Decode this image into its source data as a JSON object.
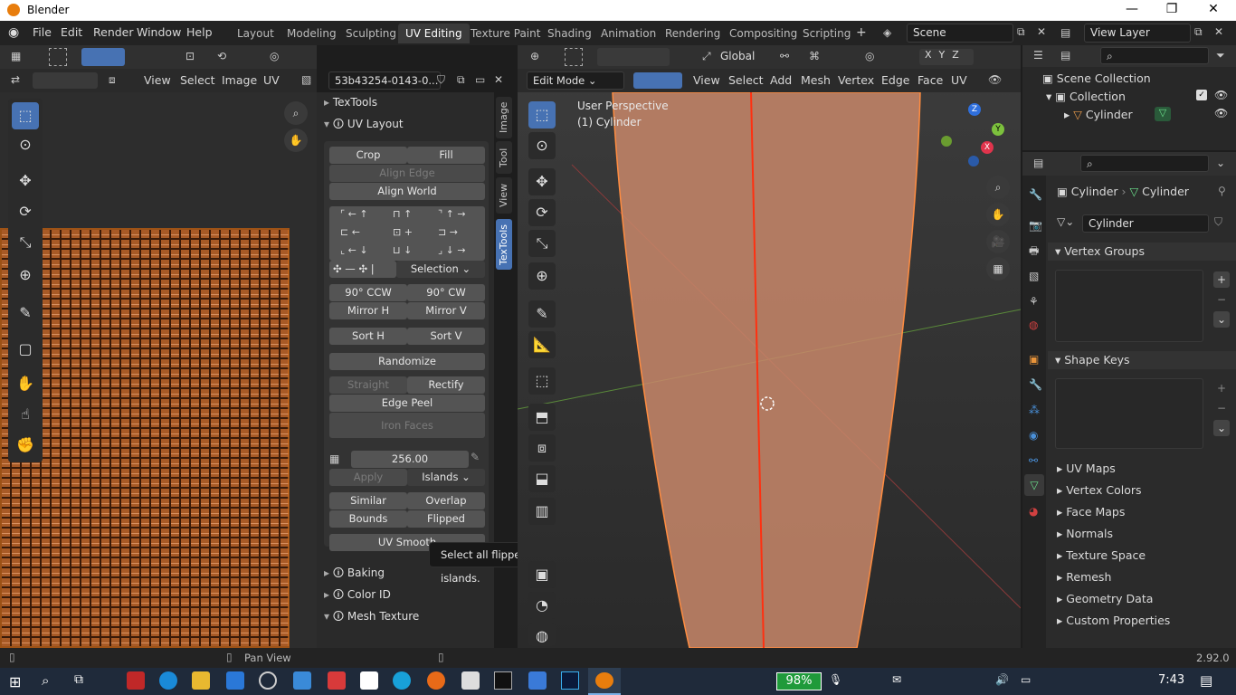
{
  "app": {
    "title": "Blender",
    "version": "2.92.0"
  },
  "menus": [
    "File",
    "Edit",
    "Render",
    "Window",
    "Help"
  ],
  "workspaces": [
    "Layout",
    "Modeling",
    "Sculpting",
    "UV Editing",
    "Texture Paint",
    "Shading",
    "Animation",
    "Rendering",
    "Compositing",
    "Scripting"
  ],
  "active_workspace": "UV Editing",
  "scene": "Scene",
  "view_layer": "View Layer",
  "uv_editor": {
    "menus": [
      "View",
      "Select",
      "Image",
      "UV"
    ],
    "image_name": "53b43254-0143-0..."
  },
  "textools": {
    "side_tabs": [
      "Image",
      "Tool",
      "View",
      "TexTools"
    ],
    "active_tab": "TexTools",
    "panel_title": "TexTools",
    "uv_layout_title": "UV Layout",
    "crop": "Crop",
    "fill": "Fill",
    "align_edge": "Align Edge",
    "align_world": "Align World",
    "selection": "Selection",
    "rot_ccw": "90° CCW",
    "rot_cw": "90° CW",
    "mirror_h": "Mirror H",
    "mirror_v": "Mirror V",
    "sort_h": "Sort H",
    "sort_v": "Sort V",
    "randomize": "Randomize",
    "straight": "Straight",
    "rectify": "Rectify",
    "edge_peel": "Edge Peel",
    "iron_faces": "Iron Faces",
    "size_value": "256.00",
    "apply": "Apply",
    "islands": "Islands",
    "similar": "Similar",
    "overlap": "Overlap",
    "bounds": "Bounds",
    "flipped": "Flipped",
    "uv_smooth": "UV Smooth",
    "tooltip": "Select all flipped UV islands.",
    "baking": "Baking",
    "color_id": "Color ID",
    "mesh_texture": "Mesh Texture"
  },
  "viewport": {
    "mode": "Edit Mode",
    "menus": [
      "View",
      "Select",
      "Add",
      "Mesh",
      "Vertex",
      "Edge",
      "Face",
      "UV"
    ],
    "orientation": "Global",
    "overlay_title": "User Perspective",
    "overlay_object": "(1) Cylinder",
    "axes": [
      "X",
      "Y",
      "Z"
    ]
  },
  "outliner": {
    "root": "Scene Collection",
    "collection": "Collection",
    "object": "Cylinder"
  },
  "properties": {
    "breadcrumb_obj": "Cylinder",
    "breadcrumb_data": "Cylinder",
    "data_name": "Cylinder",
    "sections": [
      {
        "label": "Vertex Groups",
        "open": true
      },
      {
        "label": "Shape Keys",
        "open": true
      }
    ],
    "collapsed": [
      "UV Maps",
      "Vertex Colors",
      "Face Maps",
      "Normals",
      "Texture Space",
      "Remesh",
      "Geometry Data",
      "Custom Properties"
    ]
  },
  "statusbar": {
    "pan": "Pan View"
  },
  "taskbar": {
    "battery": "98%",
    "time": "7:43"
  }
}
